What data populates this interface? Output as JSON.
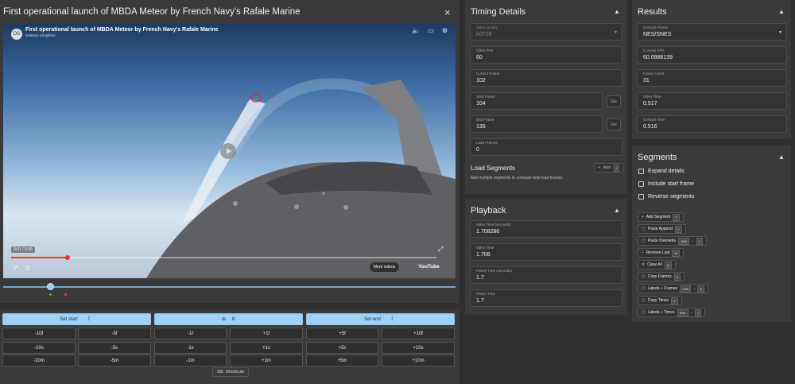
{
  "video": {
    "title": "First operational launch of MBDA Meteor by French Navy's Rafale Marine",
    "close_icon": "×",
    "yt_title": "First operational launch of MBDA Meteor by French Navy's Rafale Marine",
    "yt_channel": "Defence Simplified",
    "yt_avatar": "DS",
    "yt_time": "0:01 / 0:16",
    "more_videos": "More videos",
    "yt_logo": "YouTube"
  },
  "controls": {
    "set_start": "Set start",
    "keyframe": "K",
    "set_end": "Set end",
    "row1": [
      "-10f",
      "-5f",
      "-1f",
      "+1f",
      "+5f",
      "+10f"
    ],
    "row2": [
      "-10s",
      "-5s",
      "-1s",
      "+1s",
      "+5s",
      "+10s"
    ],
    "row3": [
      "-10m",
      "-5m",
      "-1m",
      "+1m",
      "+5m",
      "+10m"
    ],
    "shortcuts": "Shortcuts"
  },
  "timing": {
    "title": "Timing Details",
    "fields": [
      {
        "label": "Video Quality",
        "value": "hd720"
      },
      {
        "label": "Video FPS",
        "value": "60"
      },
      {
        "label": "Current Frame",
        "value": "102"
      },
      {
        "label": "Start Frame",
        "value": "104"
      },
      {
        "label": "End Frame",
        "value": "135"
      },
      {
        "label": "Load Frames",
        "value": "0"
      }
    ],
    "go": "Go",
    "load_segments_title": "Load Segments",
    "load_segments_desc": "Add multiple segments to compute total load frames.",
    "add_label": "Add",
    "add_kbd": "I"
  },
  "playback": {
    "title": "Playback",
    "fields": [
      {
        "label": "Video Time (seconds)",
        "value": "1.708286"
      },
      {
        "label": "Video Time",
        "value": "1.708"
      },
      {
        "label": "Frame Time (seconds)",
        "value": "1.7"
      },
      {
        "label": "Frame Time",
        "value": "1.7"
      }
    ]
  },
  "results": {
    "title": "Results",
    "fields": [
      {
        "label": "Console Preset",
        "value": "NES/SNES"
      },
      {
        "label": "Console FPS",
        "value": "60.0988139"
      },
      {
        "label": "Frame Count",
        "value": "31"
      },
      {
        "label": "Video Time",
        "value": "0.517"
      },
      {
        "label": "Console Time",
        "value": "0.516"
      }
    ]
  },
  "segments": {
    "title": "Segments",
    "checks": [
      "Expand details",
      "Include start frame",
      "Reverse segments"
    ],
    "buttons": [
      {
        "label": "Add Segment",
        "icon": "+",
        "keys": [
          "T"
        ]
      },
      {
        "label": "Paste Append",
        "icon": "▢",
        "keys": [
          "V"
        ]
      },
      {
        "label": "Paste Overwrite",
        "icon": "▢",
        "keys": [
          "Shift",
          "V"
        ]
      },
      {
        "label": "Remove Last",
        "icon": "−",
        "keys": [
          "W"
        ]
      },
      {
        "label": "Clear All",
        "icon": "✕",
        "keys": [
          "Q"
        ]
      },
      {
        "label": "Copy Frames",
        "icon": "▢",
        "keys": [
          "E"
        ]
      },
      {
        "label": "Labels + Frames",
        "icon": "▢",
        "keys": [
          "Shift",
          "E"
        ]
      },
      {
        "label": "Copy Times",
        "icon": "▢",
        "keys": [
          "Z"
        ]
      },
      {
        "label": "Labels + Times",
        "icon": "▢",
        "keys": [
          "Shift",
          "Z"
        ]
      }
    ]
  }
}
